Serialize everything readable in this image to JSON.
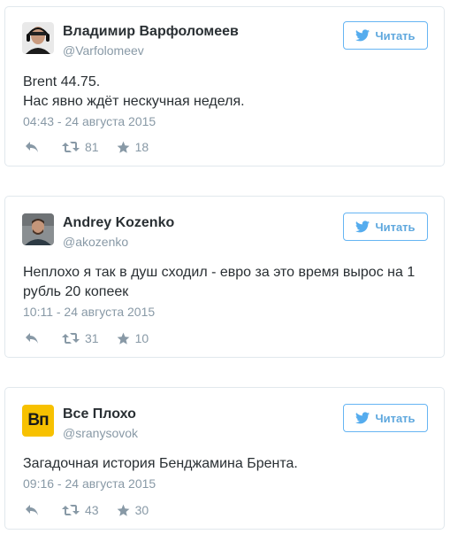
{
  "follow_label": "Читать",
  "colors": {
    "accent": "#55acee",
    "muted": "#8899a6",
    "text": "#292f33",
    "border": "#e1e8ed",
    "vp_logo_bg": "#f7c100"
  },
  "icons": {
    "reply": "reply-arrow-icon",
    "retweet": "retweet-icon",
    "favorite": "star-icon",
    "bird": "twitter-bird-icon"
  },
  "tweets": [
    {
      "name": "Владимир Варфоломеев",
      "handle": "@Varfolomeev",
      "text": [
        "Brent 44.75.",
        "Нас явно ждёт нескучная неделя."
      ],
      "time": "04:43 - 24 августа 2015",
      "retweets": "81",
      "favorites": "18"
    },
    {
      "name": "Andrey Kozenko",
      "handle": "@akozenko",
      "text": [
        "Неплохо я так в душ сходил - евро за это время вырос на 1",
        "рубль 20 копеек"
      ],
      "time": "10:11 - 24 августа 2015",
      "retweets": "31",
      "favorites": "10"
    },
    {
      "name": "Все Плохо",
      "handle": "@sranysovok",
      "logo_text": "Вп",
      "text": [
        "Загадочная история Бенджамина Брента."
      ],
      "time": "09:16 - 24 августа 2015",
      "retweets": "43",
      "favorites": "30"
    }
  ]
}
